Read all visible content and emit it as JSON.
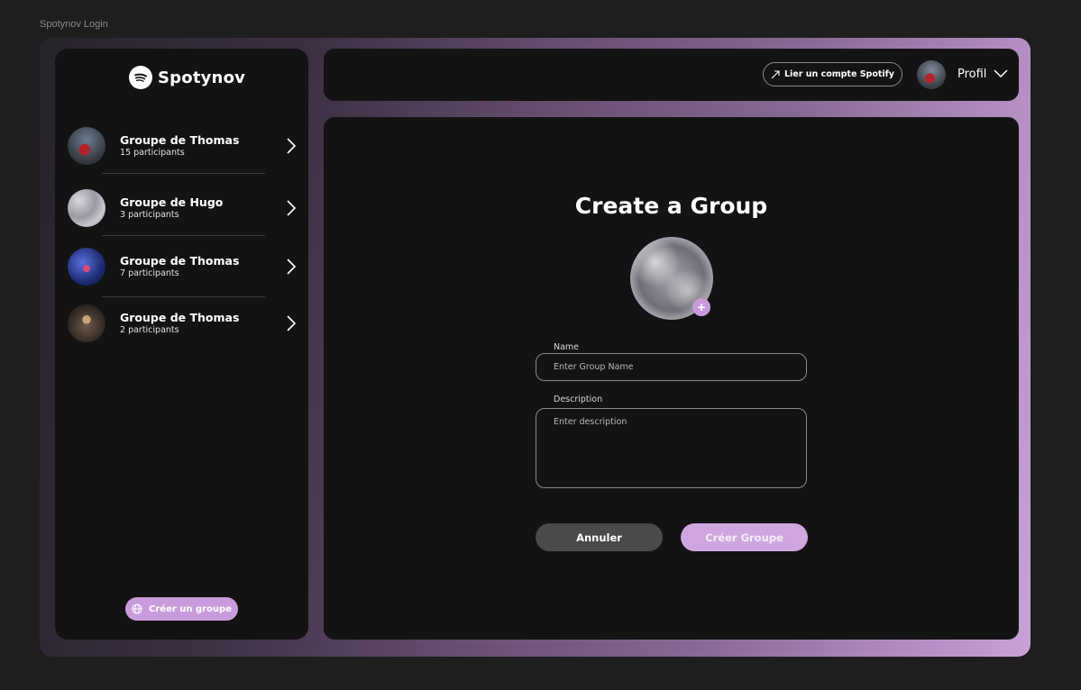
{
  "frame_label": "Spotynov Login",
  "sidebar": {
    "logo_text": "Spotynov",
    "groups": [
      {
        "name": "Groupe de Thomas",
        "count": "15 participants"
      },
      {
        "name": "Groupe de Hugo",
        "count": "3 participants"
      },
      {
        "name": "Groupe de Thomas",
        "count": "7 participants"
      },
      {
        "name": "Groupe de Thomas",
        "count": "2 participants"
      }
    ],
    "create_group_label": "Créer un groupe"
  },
  "topbar": {
    "link_spotify_label": "Lier un compte Spotify",
    "profile_label": "Profil"
  },
  "main": {
    "title": "Create a Group",
    "name_label": "Name",
    "name_placeholder": "Enter Group Name",
    "name_value": "",
    "description_label": "Description",
    "description_placeholder": "Enter description",
    "description_value": "",
    "add_image_symbol": "+",
    "cancel_label": "Annuler",
    "submit_label": "Créer Groupe"
  },
  "colors": {
    "accent": "#c99bdc",
    "panel": "#141314",
    "background": "#1e1e1e"
  },
  "icons": [
    "spotify-logo-icon",
    "chevron-right-icon",
    "globe-icon",
    "arrow-up-right-icon",
    "chevron-down-icon",
    "plus-icon"
  ]
}
